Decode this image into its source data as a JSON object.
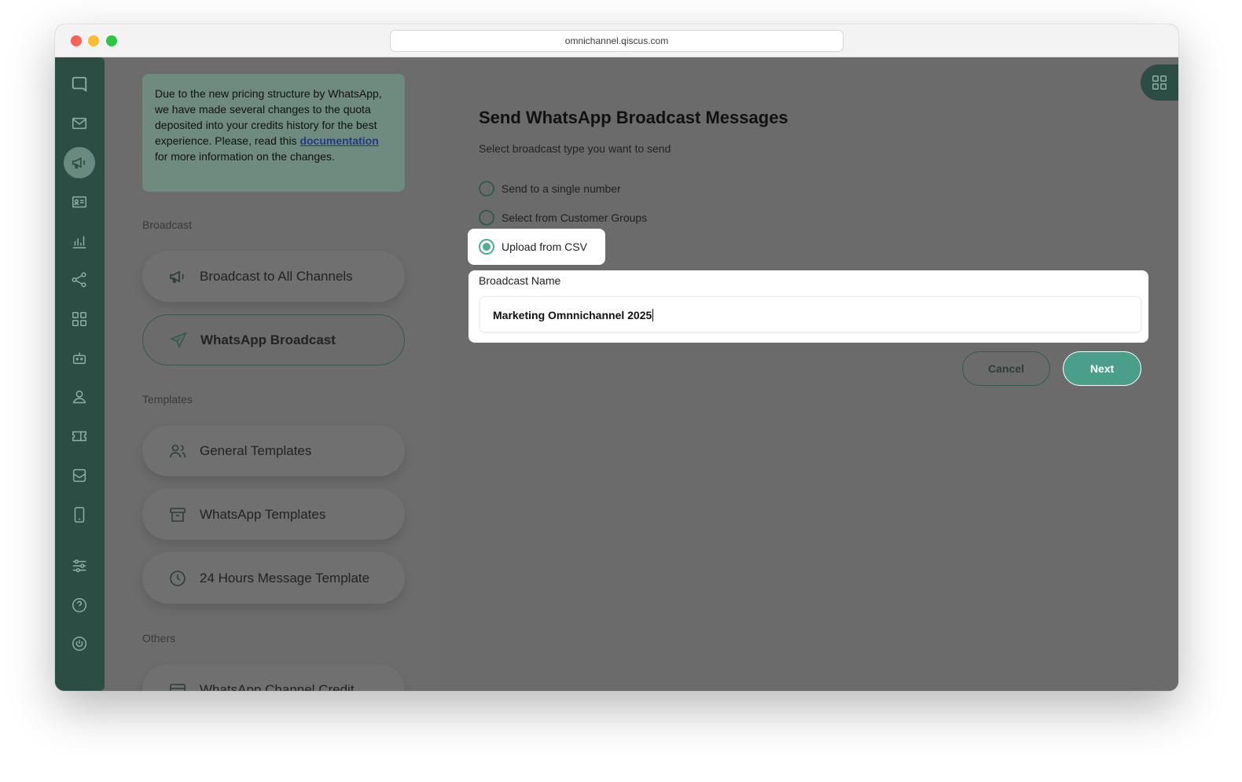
{
  "browser": {
    "url": "omnichannel.qiscus.com"
  },
  "notice": {
    "text_before": "Due to the new pricing structure by WhatsApp, we have made several changes to the quota deposited into your credits history for the best experience. Please, read this ",
    "link_text": "documentation",
    "text_after": " for more information on the changes."
  },
  "sidebar": {
    "sections": {
      "broadcast": "Broadcast",
      "templates": "Templates",
      "others": "Others"
    },
    "items": [
      {
        "label": "Broadcast to All Channels",
        "icon": "megaphone-icon"
      },
      {
        "label": "WhatsApp Broadcast",
        "icon": "send-icon",
        "selected": true
      },
      {
        "label": "General Templates",
        "icon": "users-icon"
      },
      {
        "label": "WhatsApp Templates",
        "icon": "archive-icon"
      },
      {
        "label": "24 Hours Message Template",
        "icon": "clock-icon"
      },
      {
        "label": "WhatsApp Channel Credit",
        "icon": "card-icon"
      }
    ]
  },
  "main": {
    "title": "Send WhatsApp Broadcast Messages",
    "subtitle": "Select broadcast type you want to send",
    "options": [
      {
        "label": "Send to a single number",
        "checked": false
      },
      {
        "label": "Select from Customer Groups",
        "checked": false
      },
      {
        "label": "Upload from CSV",
        "checked": true
      }
    ],
    "broadcast_name_label": "Broadcast Name",
    "broadcast_name_value": "Marketing Omnnichannel 2025",
    "cancel_label": "Cancel",
    "next_label": "Next"
  },
  "colors": {
    "rail": "#2b4d43",
    "accent": "#4a9f8b",
    "overlay": "#6b6b6b"
  }
}
